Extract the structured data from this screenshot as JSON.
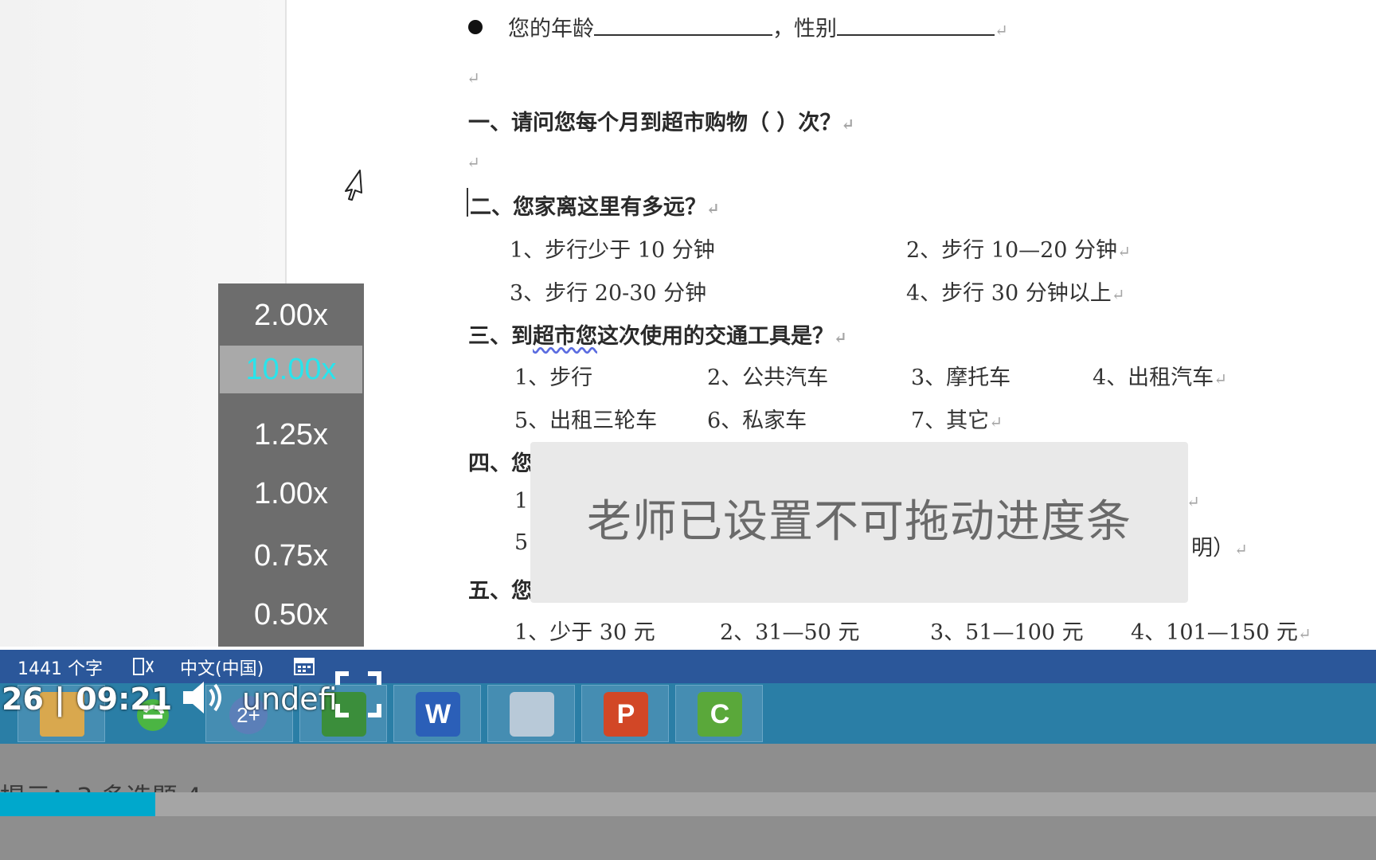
{
  "document": {
    "q_age_label": "您的年龄",
    "q_gender_label": "，性别",
    "q1": "一、请问您每个月到超市购物（    ）次？",
    "q2": "二、您家离这里有多远？",
    "q2_options": [
      "1、步行少于 10 分钟",
      "2、步行 10—20 分钟",
      "3、步行 20-30 分钟",
      "4、步行 30 分钟以上"
    ],
    "q3_prefix": "三、到",
    "q3_squiggle": "超市您",
    "q3_suffix": "这次使用的交通工具是？",
    "q3_options": [
      "1、步行",
      "2、公共汽车",
      "3、摩托车",
      "4、出租汽车",
      "5、出租三轮车",
      "6、私家车",
      "7、其它"
    ],
    "q4_partial": "四、您",
    "q4_line1_start": "1",
    "q4_line2_start": "5",
    "q4_line2_end": "明）",
    "q5_partial": "五、您",
    "q5_options": [
      "1、少于 30 元",
      "2、31—50 元",
      "3、51—100 元",
      "4、101—150 元"
    ],
    "paragraph_mark": "↵"
  },
  "speed_menu": {
    "options": [
      "2.00x",
      "10.00x",
      "1.25x",
      "1.00x",
      "0.75x",
      "0.50x"
    ],
    "selected": "10.00x"
  },
  "toast": {
    "text": "老师已设置不可拖动进度条"
  },
  "status_bar": {
    "word_count": "1441 个字",
    "language": "中文(中国)"
  },
  "taskbar": {
    "time": "26 | 09:21",
    "player_label": "undefi",
    "apps": [
      "printer",
      "ie",
      "calculator",
      "camtasia",
      "word",
      "notes",
      "powerpoint",
      "camtasia-recorder"
    ],
    "word_letter": "W",
    "ppt_letter": "P",
    "cam_letter": "C"
  },
  "player": {
    "caption": "提示：3  多选题      4",
    "progress_fraction": 0.113
  },
  "colors": {
    "status_bar": "#2b579a",
    "taskbar": "#2a7ea6",
    "selected_speed_text": "#29e4ec",
    "progress": "#00a8cc"
  }
}
